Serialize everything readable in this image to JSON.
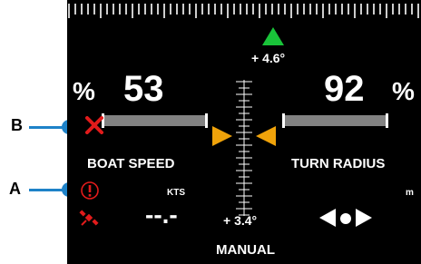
{
  "colors": {
    "background": "#000000",
    "text": "#ffffff",
    "bar": "#828282",
    "indicator_arrow": "#f0a30a",
    "heading_arrow": "#19c339",
    "warning": "#e11b1b",
    "callout": "#1e82c8"
  },
  "callouts": {
    "b": "B",
    "a": "A"
  },
  "heading": {
    "offset": "+ 4.6°"
  },
  "boat_speed": {
    "percent_symbol": "%",
    "value": "53",
    "label": "BOAT SPEED",
    "unit": "KTS",
    "speed_value": "--.-"
  },
  "turn_radius": {
    "percent_symbol": "%",
    "value": "92",
    "label": "TURN RADIUS",
    "unit": "m"
  },
  "center": {
    "offset_bottom": "+ 3.4°"
  },
  "mode": {
    "label": "MANUAL"
  },
  "icons": {
    "x_mark": "x-mark-icon",
    "warning": "warning-circle-icon",
    "satellite": "satellite-icon",
    "left_arrow": "left-arrow-icon",
    "dot": "dot-icon",
    "right_arrow": "right-arrow-icon"
  }
}
